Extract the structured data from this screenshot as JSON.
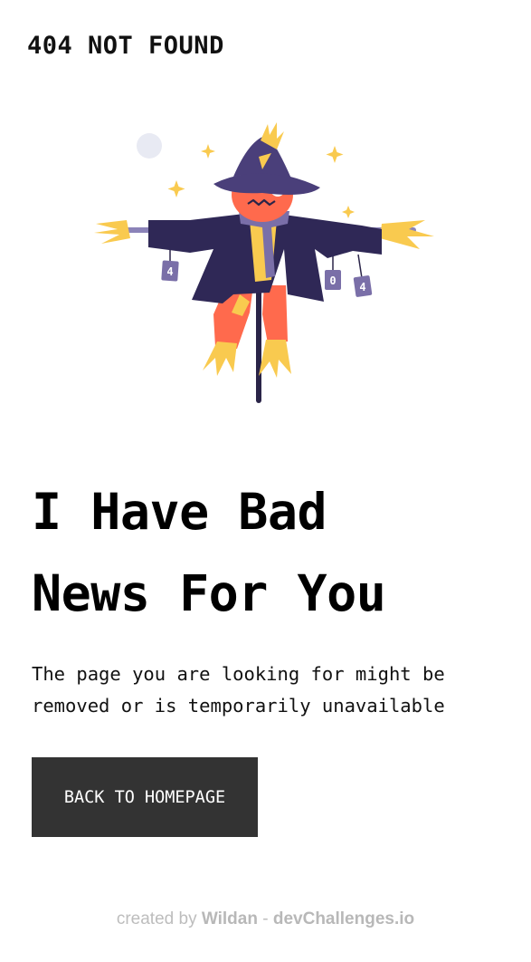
{
  "header": {
    "brand": "404 NOT FOUND"
  },
  "hero": {
    "headline_line1": "I Have Bad",
    "headline_line2": "News For You",
    "message_line1": "The page you are looking for might be",
    "message_line2": "removed or is temporarily unavailable",
    "cta_label": "BACK TO HOMEPAGE",
    "can_labels": [
      "4",
      "0",
      "4"
    ]
  },
  "footer": {
    "prefix": "created by",
    "author": "Wildan",
    "separator": "-",
    "site": "devChallenges.io"
  },
  "colors": {
    "hat": "#4a3f7a",
    "coat": "#2f2856",
    "body": "#ff6a4d",
    "straw": "#f9ca4f",
    "scarf": "#7a6fa8",
    "moon": "#e8eaf3",
    "button_bg": "#333333",
    "footer_text": "#bdbdbd"
  },
  "icons": {
    "illustration": "scarecrow-illustration"
  }
}
